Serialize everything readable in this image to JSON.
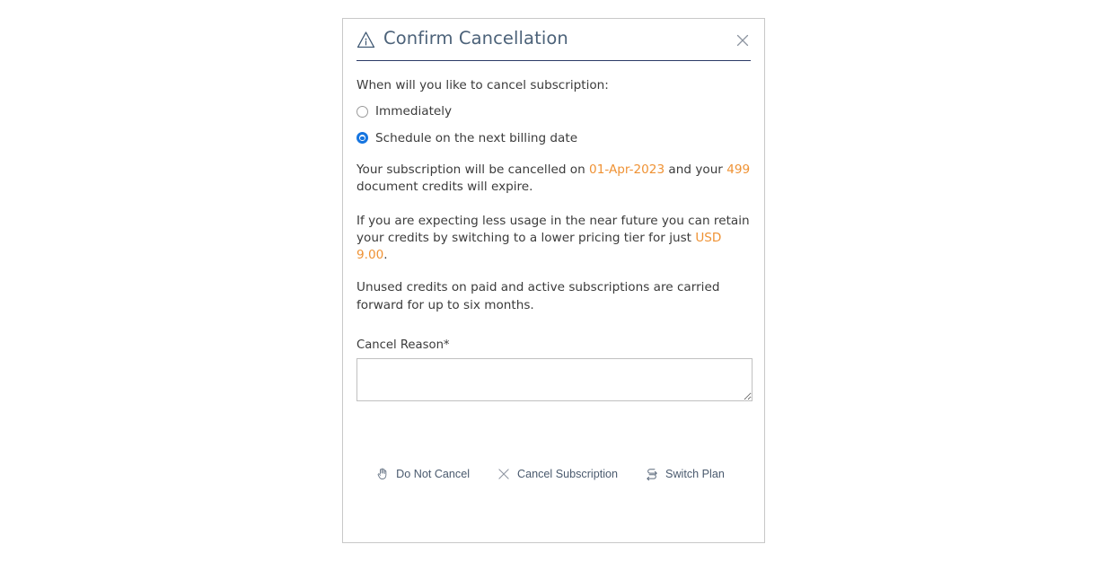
{
  "dialog": {
    "title": "Confirm Cancellation",
    "warning_icon": "warning-info-triangle-icon",
    "close_icon": "close-icon",
    "question": "When will you like to cancel subscription:",
    "options": [
      {
        "label": "Immediately",
        "selected": false
      },
      {
        "label": "Schedule on the next billing date",
        "selected": true
      }
    ],
    "notice": {
      "part1": "Your subscription will be cancelled on ",
      "date": "01-Apr-2023",
      "part2": " and your ",
      "credits": "499",
      "part3": " document credits will expire."
    },
    "retain": {
      "part1": "If you are expecting less usage in the near future you can retain your credits by switching to a lower pricing tier for just ",
      "price": "USD 9.00",
      "part2": "."
    },
    "carryover": "Unused credits on paid and active subscriptions are carried forward for up to six months.",
    "reason": {
      "label": "Cancel Reason*",
      "value": "",
      "placeholder": ""
    },
    "actions": [
      {
        "label": "Do Not Cancel",
        "icon": "hand-stop-icon"
      },
      {
        "label": "Cancel Subscription",
        "icon": "close-x-icon"
      },
      {
        "label": "Switch Plan",
        "icon": "swap-arrows-icon"
      }
    ],
    "colors": {
      "accent_orange": "#ef9234",
      "radio_blue": "#1675e0",
      "title_slate": "#4c6279",
      "rule_navy": "#2b3a67",
      "border_gray": "#c8c8c8"
    }
  }
}
